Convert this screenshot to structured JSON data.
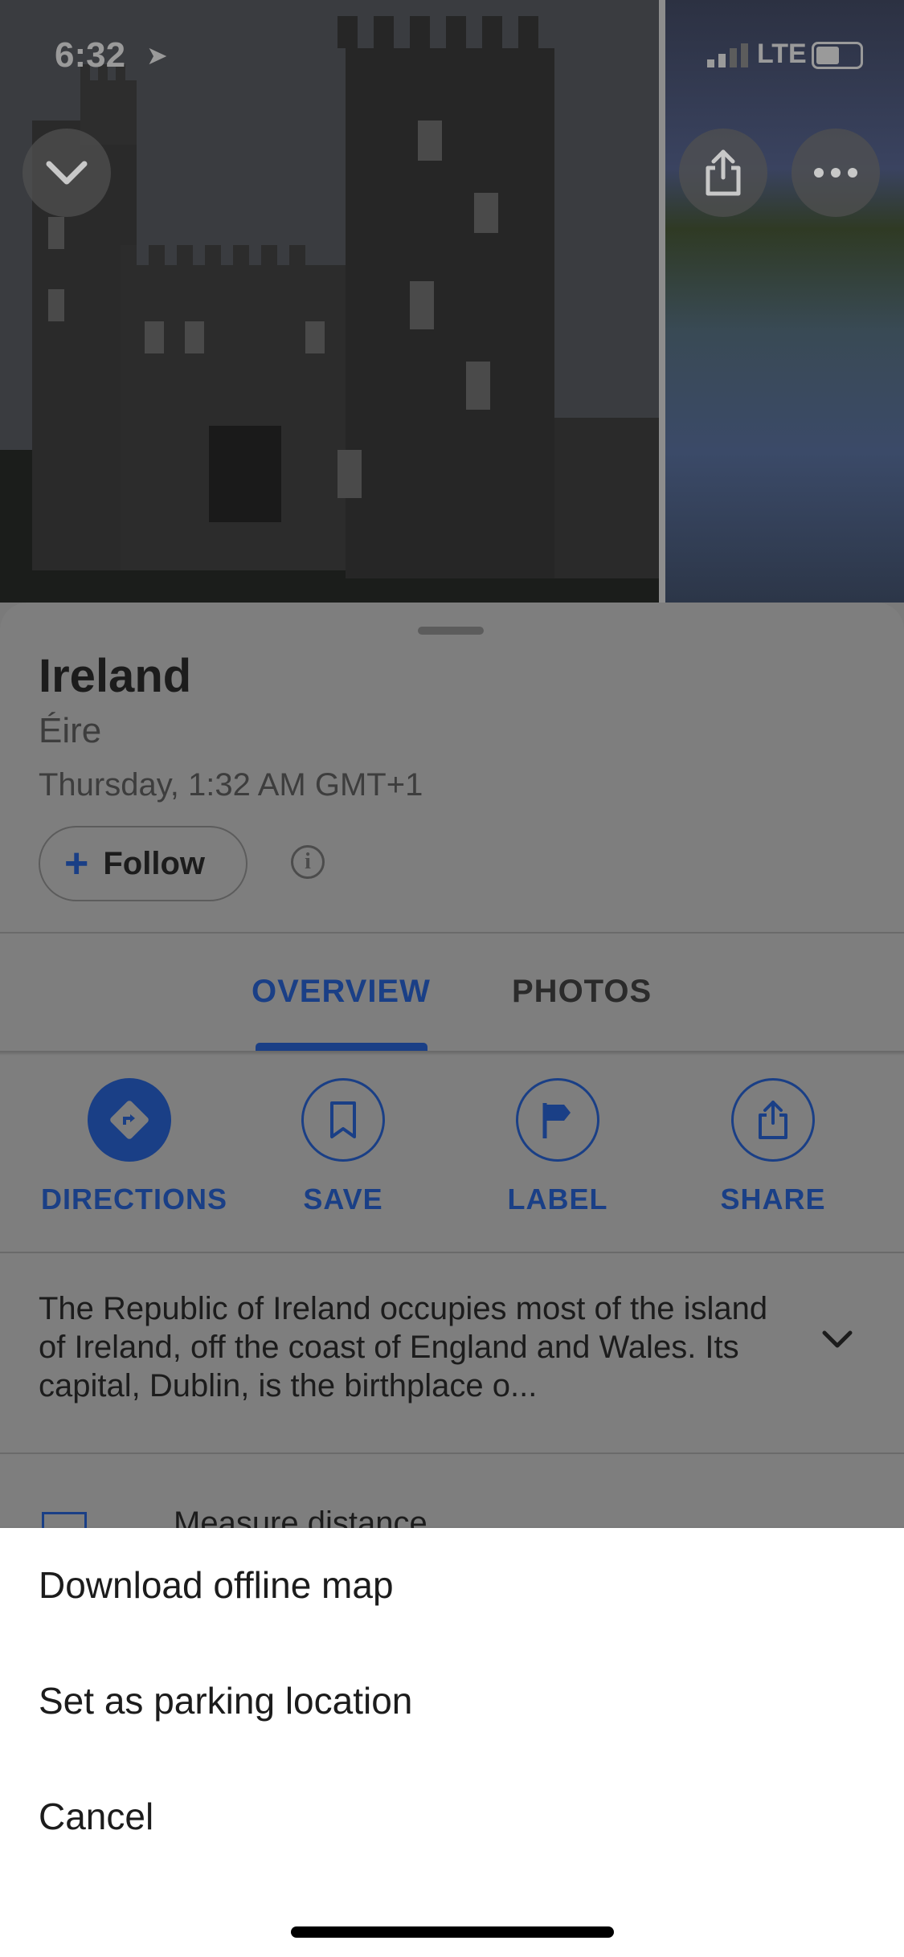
{
  "status_bar": {
    "time": "6:32",
    "network": "LTE"
  },
  "header_buttons": {
    "collapse_icon": "chevron-down-icon",
    "share_icon": "share-icon",
    "more_icon": "more-horizontal-icon"
  },
  "place": {
    "title": "Ireland",
    "subtitle": "Éire",
    "datetime": "Thursday, 1:32 AM GMT+1",
    "follow_label": "Follow"
  },
  "tabs": [
    {
      "label": "OVERVIEW",
      "active": true
    },
    {
      "label": "PHOTOS",
      "active": false
    }
  ],
  "actions": [
    {
      "label": "DIRECTIONS",
      "icon": "directions-icon"
    },
    {
      "label": "SAVE",
      "icon": "bookmark-icon"
    },
    {
      "label": "LABEL",
      "icon": "flag-icon"
    },
    {
      "label": "SHARE",
      "icon": "share-icon"
    }
  ],
  "description": "The Republic of Ireland occupies most of the island of Ireland, off the coast of England and Wales. Its capital, Dublin, is the birthplace o...",
  "partial_row": {
    "label": "Measure distance",
    "icon": "ruler-icon"
  },
  "menu": {
    "download": "Download offline map",
    "parking": "Set as parking location",
    "cancel": "Cancel"
  },
  "colors": {
    "accent": "#1a3f86",
    "sheet_bg": "#ffffff",
    "dim_overlay": "#7e7e7e"
  }
}
